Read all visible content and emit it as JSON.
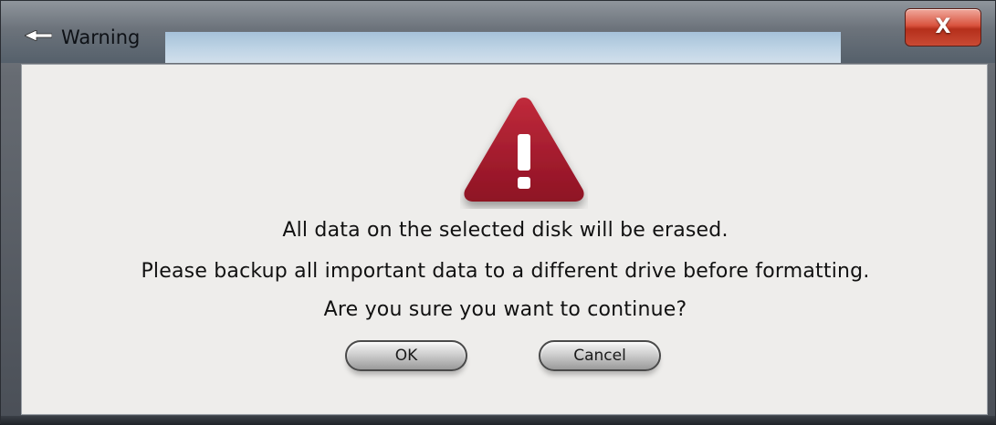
{
  "window": {
    "title": "Warning",
    "title_icon": "eject-arrow-icon",
    "close_label": "X"
  },
  "dialog": {
    "icon": "warning-triangle-icon",
    "icon_color": "#a11b2c",
    "messages": [
      "All data on the selected disk will be erased.",
      "Please backup all important data to a different drive before formatting.",
      "Are you sure you want to continue?"
    ]
  },
  "buttons": {
    "ok_label": "OK",
    "cancel_label": "Cancel"
  }
}
